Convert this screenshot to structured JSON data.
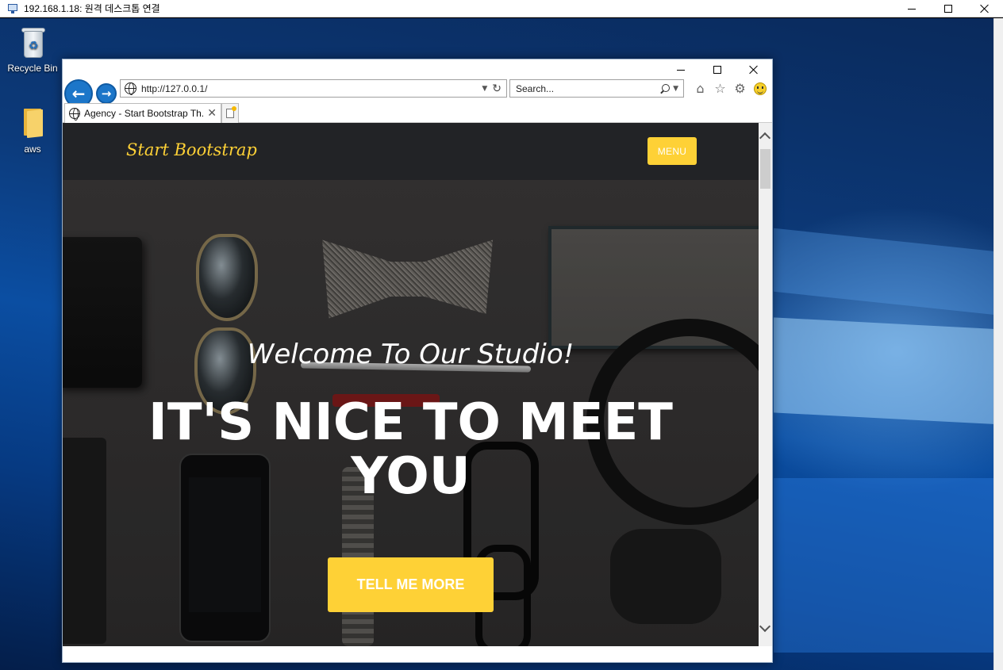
{
  "rdp": {
    "title": "192.168.1.18: 원격 데스크톱 연결",
    "icon": "remote-desktop-icon"
  },
  "desktop": {
    "icons": [
      {
        "label": "Recycle Bin",
        "icon": "recycle-bin-icon"
      },
      {
        "label": "aws",
        "icon": "folder-icon"
      }
    ]
  },
  "browser": {
    "address": "http://127.0.0.1/",
    "search_placeholder": "Search...",
    "tab_title": "Agency - Start Bootstrap Th...",
    "toolbar_icons": [
      "home-icon",
      "favorites-star-icon",
      "settings-gear-icon",
      "feedback-smiley-icon"
    ]
  },
  "site": {
    "brand": "Start Bootstrap",
    "menu_label": "MENU",
    "hero_subheading": "Welcome To Our Studio!",
    "hero_heading": "IT'S NICE TO MEET YOU",
    "cta_label": "TELL ME MORE",
    "accent_color": "#fed136",
    "nav_bg_color": "#222326"
  }
}
